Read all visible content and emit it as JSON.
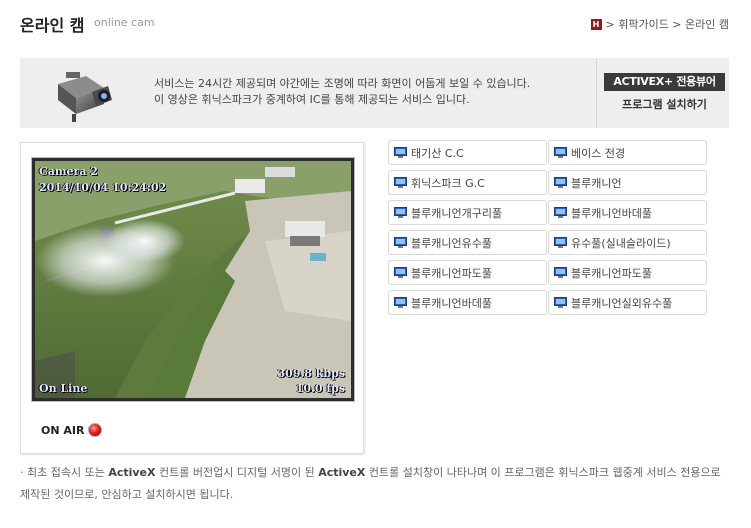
{
  "header": {
    "title": "온라인 캠",
    "subtitle": "online cam",
    "home_icon_label": "H",
    "breadcrumb": "> 휘팍가이드 > 온라인 캠"
  },
  "service": {
    "line1": "서비스는 24시간 제공되며 야간에는 조명에 따라 화면이 어둡게 보일 수 있습니다.",
    "line2": "이 영상은 휘닉스파크가 중계하여 IC를 통해 제공되는 서비스 입니다.",
    "activex_badge": "ACTIVEX+ 전용뷰어",
    "install_label": "프로그램 설치하기"
  },
  "player": {
    "camera_label": "Camera 2",
    "timestamp": "2014/10/04 10:24:02",
    "bitrate": "309.8 kbps",
    "fps": "10.0 fps",
    "status_overlay": "On Line",
    "on_air_label": "ON AIR"
  },
  "channels": [
    {
      "label": "태기산 C.C"
    },
    {
      "label": "베이스 전경"
    },
    {
      "label": "휘닉스파크 G.C"
    },
    {
      "label": "블루캐니언"
    },
    {
      "label": "블루캐니언개구리풀"
    },
    {
      "label": "블루캐니언바데풀"
    },
    {
      "label": "블루캐니언유수풀"
    },
    {
      "label": "유수풀(실내슬라이드)"
    },
    {
      "label": "블루캐니언파도풀"
    },
    {
      "label": "블루캐니언파도풀"
    },
    {
      "label": "블루캐니언바데풀"
    },
    {
      "label": "블루캐니언실외유수풀"
    }
  ],
  "notice": {
    "part1": "· 최초 접속시 또는 ",
    "bold1": "ActiveX",
    "part2": " 컨트롤 버전업시 디지털 서명이 된 ",
    "bold2": "ActiveX",
    "part3": " 컨트롤 설치창이 나타나며 이 프로그램은 휘닉스파크 웹중계 서비스 전용으로 제작된 것이므로, 안심하고 설치하시면 됩니다."
  },
  "colors": {
    "accent_dark": "#3a3a3a",
    "home_icon": "#8b1d1d",
    "on_air": "#e02020",
    "panel_bg": "#eeeeee"
  }
}
